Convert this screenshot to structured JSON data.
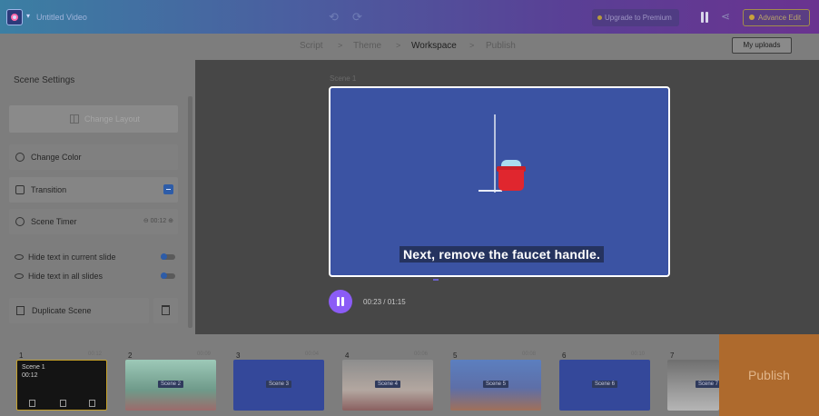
{
  "app": {
    "project_title": "Untitled Video",
    "logo_icon": "video-logo-icon",
    "undo_icon": "undo-icon",
    "redo_icon": "redo-icon",
    "upgrade_label": "Upgrade to Premium",
    "pause_icon": "pause-icon",
    "share_icon": "share-icon",
    "advance_edit_label": "Advance Edit"
  },
  "steps": [
    {
      "label": "Script",
      "active": false
    },
    {
      "label": "Theme",
      "active": false
    },
    {
      "label": "Workspace",
      "active": true
    },
    {
      "label": "Publish",
      "active": false
    }
  ],
  "step_separator": ">",
  "my_uploads_label": "My uploads",
  "sidebar": {
    "title": "Scene Settings",
    "change_layout_label": "Change Layout",
    "change_color_label": "Change Color",
    "transition_label": "Transition",
    "transition_checked": true,
    "scene_timer_label": "Scene Timer",
    "scene_timer_value": "00:12",
    "hide_text_current_label": "Hide text in current slide",
    "hide_text_all_label": "Hide text in all slides",
    "duplicate_label": "Duplicate Scene"
  },
  "preview": {
    "scene_label": "Scene 1",
    "caption": "Next, remove the faucet handle.",
    "time_display": "00:23 / 01:15",
    "canvas_color": "#3b53a3"
  },
  "timeline": {
    "scenes": [
      {
        "number": "1",
        "duration": "00:12",
        "label": "Scene 1",
        "selected": true
      },
      {
        "number": "2",
        "duration": "00:09",
        "label": "Scene 2"
      },
      {
        "number": "3",
        "duration": "00:04",
        "label": "Scene 3"
      },
      {
        "number": "4",
        "duration": "00:06",
        "label": "Scene 4"
      },
      {
        "number": "5",
        "duration": "00:08",
        "label": "Scene 5"
      },
      {
        "number": "6",
        "duration": "00:10",
        "label": "Scene 6"
      },
      {
        "number": "7",
        "duration": "",
        "label": "Scene 7"
      }
    ],
    "scene1_time": "00:12"
  },
  "publish_label": "Publish",
  "colors": {
    "accent_purple": "#8b5cf6",
    "publish_orange": "#ae6a2d",
    "selected_border": "#c7a22a"
  }
}
